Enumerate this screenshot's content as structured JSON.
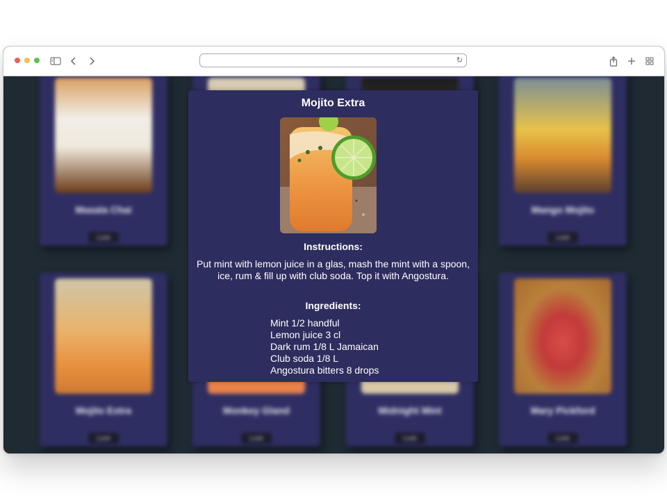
{
  "browser": {
    "traffic_lights": [
      "#ee5f57",
      "#f5be4f",
      "#5ec453"
    ],
    "url": "",
    "icons": [
      "sidebar-icon",
      "back-icon",
      "forward-icon",
      "reload-icon",
      "share-icon",
      "new-tab-icon",
      "tab-overview-icon"
    ]
  },
  "grid": {
    "cards": [
      {
        "name": "Masala Chai",
        "button": "Look"
      },
      {
        "name": "Mango Mojito",
        "button": "Look"
      },
      {
        "name": "Mojito Extra",
        "button": "Look"
      },
      {
        "name": "Monkey Gland",
        "button": "Look"
      },
      {
        "name": "Midnight Mint",
        "button": "Look"
      },
      {
        "name": "Mary Pickford",
        "button": "Look"
      }
    ]
  },
  "modal": {
    "title": "Mojito Extra",
    "instructions_heading": "Instructions:",
    "instructions": "Put mint with lemon juice in a glas, mash the mint with a spoon, ice, rum & fill up with club soda. Top it with Angostura.",
    "ingredients_heading": "Ingredients:",
    "ingredients": [
      "Mint 1/2 handful",
      "Lemon juice 3 cl",
      "Dark rum 1/8 L Jamaican",
      "Club soda 1/8 L",
      "Angostura bitters 8 drops"
    ]
  },
  "colors": {
    "page_background": "#1f2a33",
    "card_background": "#2f2e63",
    "modal_background": "#2e2d5f"
  }
}
